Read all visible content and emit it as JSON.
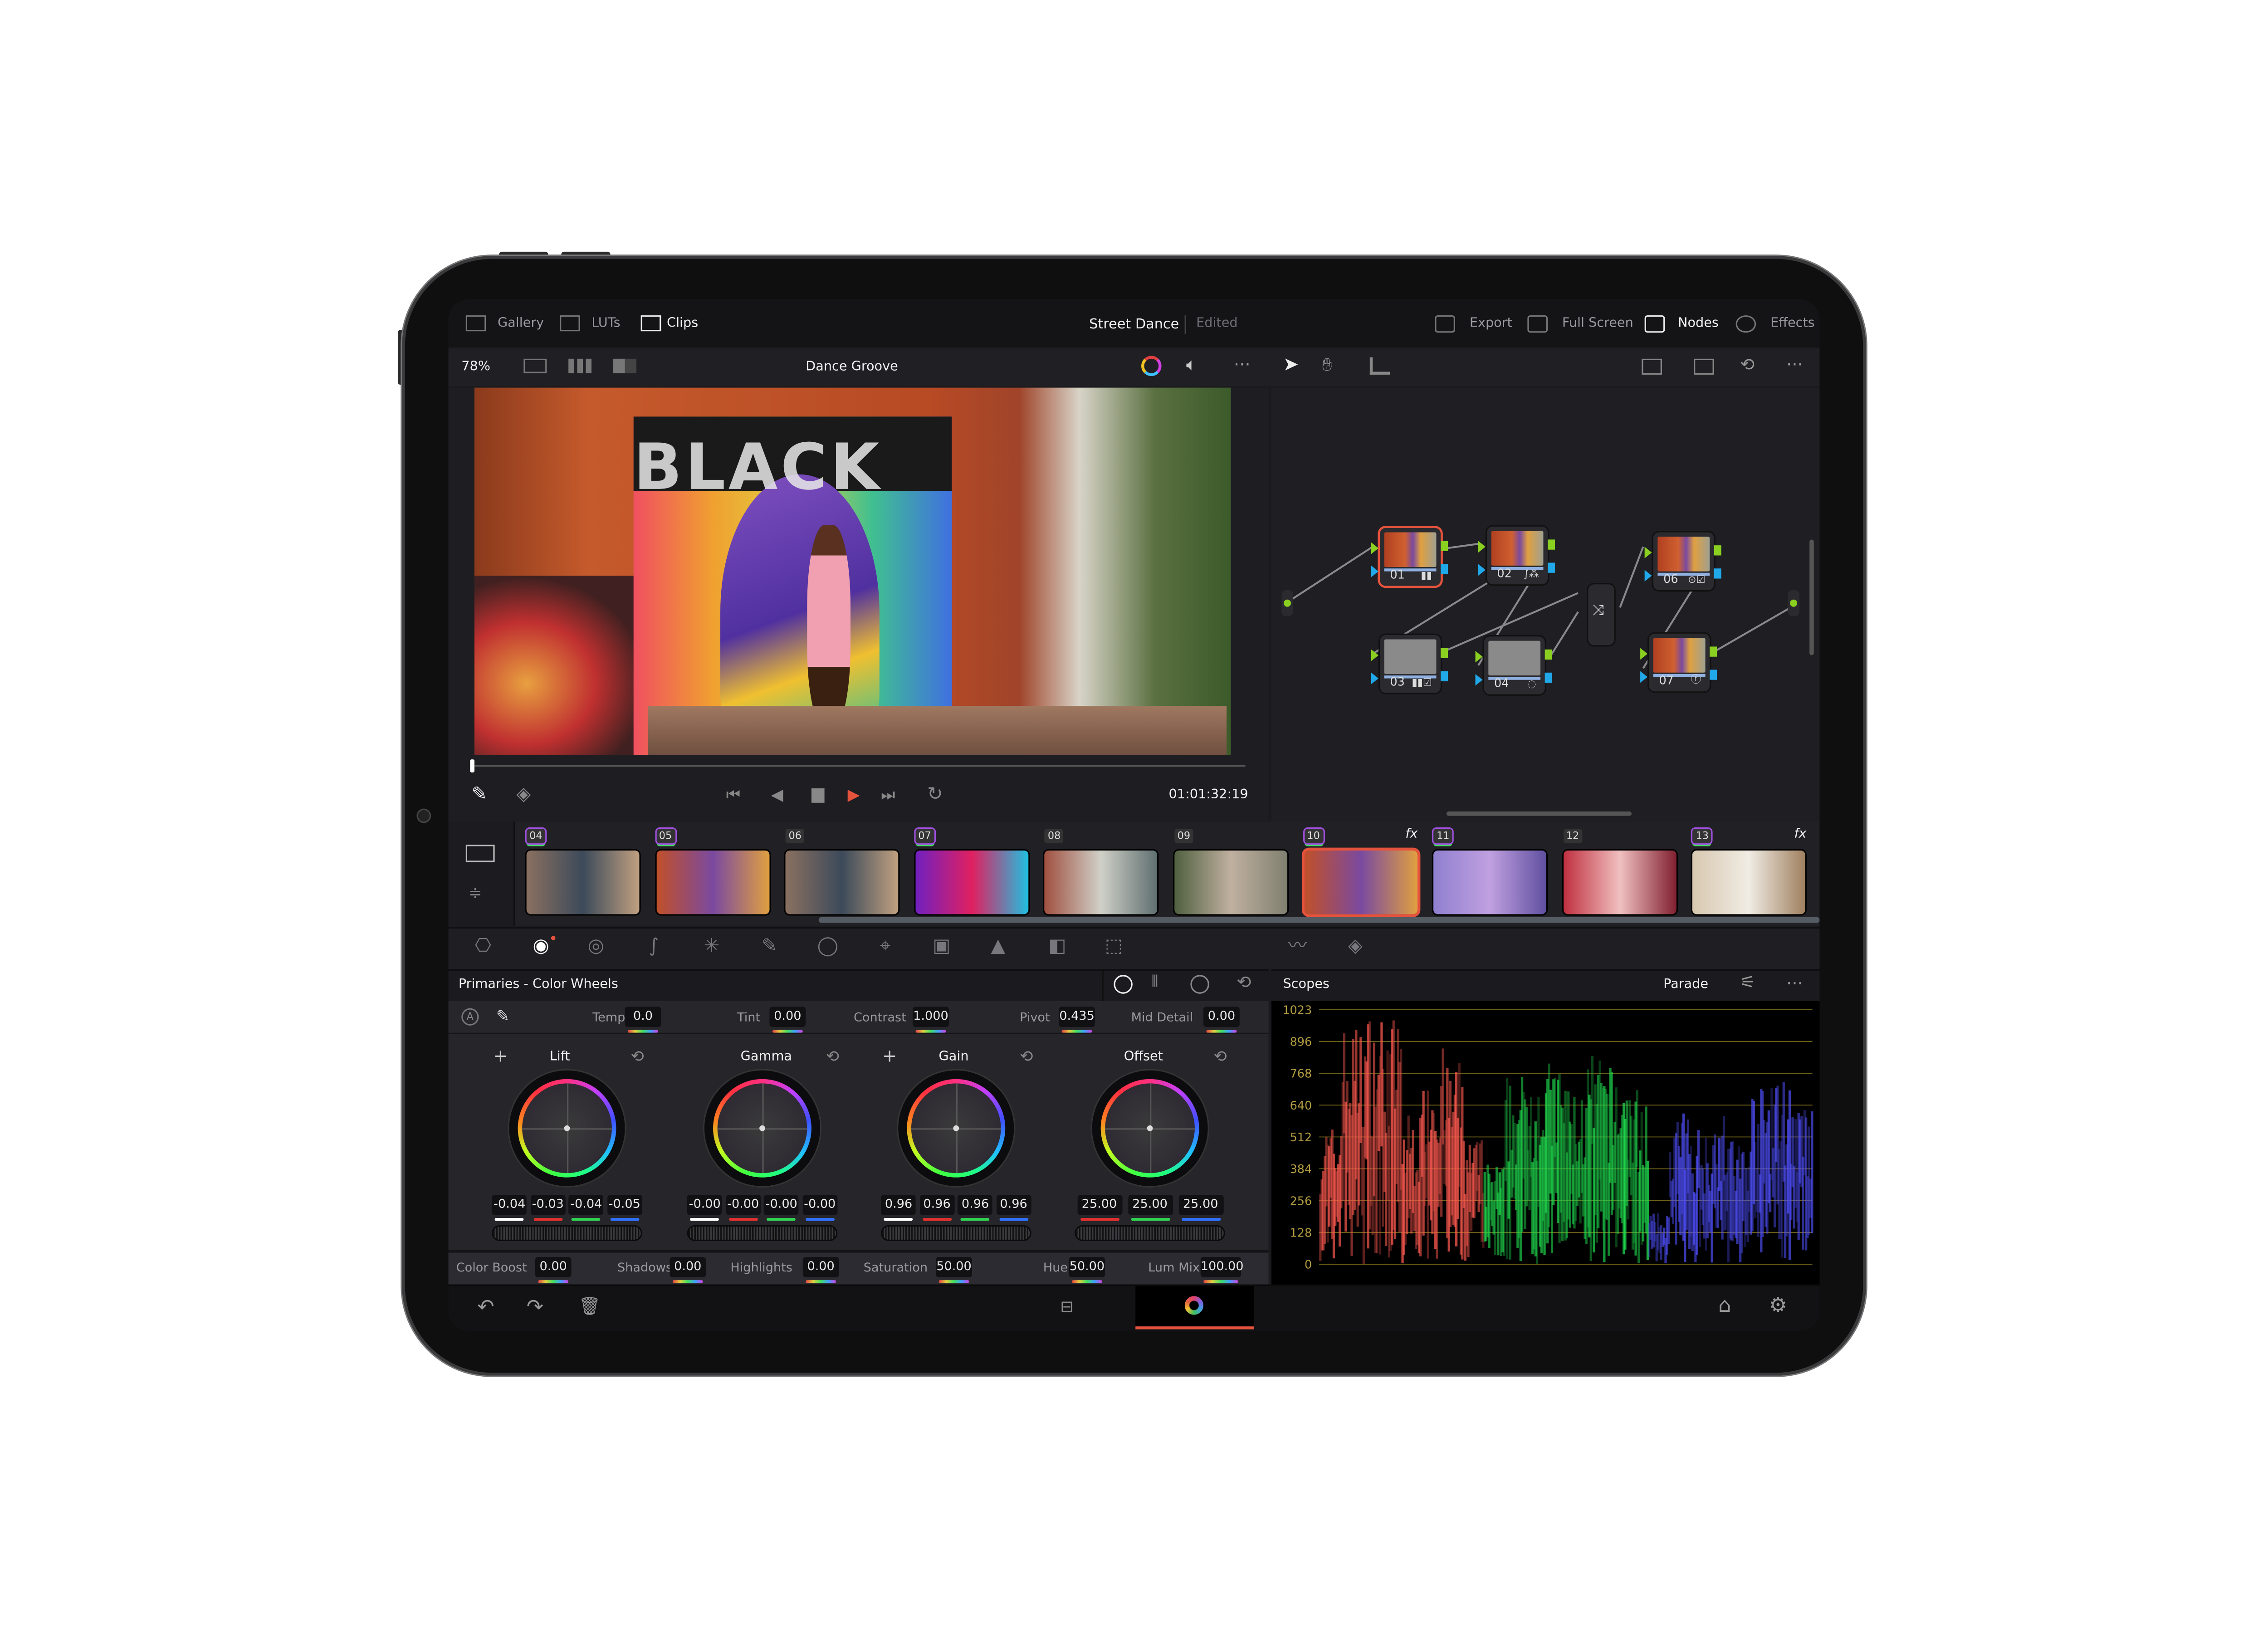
{
  "topbar": {
    "left": [
      {
        "label": "Gallery",
        "icon": "gallery-icon"
      },
      {
        "label": "LUTs",
        "icon": "luts-icon"
      },
      {
        "label": "Clips",
        "icon": "clips-icon",
        "active": true
      }
    ],
    "project_title": "Street Dance",
    "project_status": "Edited",
    "right": [
      {
        "label": "Export",
        "icon": "export-icon"
      },
      {
        "label": "Full Screen",
        "icon": "fullscreen-icon"
      },
      {
        "label": "Nodes",
        "icon": "nodes-icon",
        "active": true
      },
      {
        "label": "Effects",
        "icon": "effects-icon"
      }
    ]
  },
  "viewer": {
    "zoom": "78%",
    "clip_name": "Dance Groove",
    "timecode": "01:01:32:19",
    "playhead_fraction": 0.0
  },
  "clips": [
    {
      "num": "04",
      "flagged": true,
      "fx": false,
      "colors": [
        "#8a7060",
        "#3c4a5a",
        "#c0a080"
      ]
    },
    {
      "num": "05",
      "flagged": true,
      "fx": false,
      "colors": [
        "#c0502a",
        "#7a4aa0",
        "#e0a040"
      ]
    },
    {
      "num": "06",
      "flagged": false,
      "fx": false,
      "colors": [
        "#8a7060",
        "#3c4a5a",
        "#c0a080"
      ]
    },
    {
      "num": "07",
      "flagged": true,
      "fx": false,
      "colors": [
        "#7020c0",
        "#e02060",
        "#20c0e0"
      ]
    },
    {
      "num": "08",
      "flagged": false,
      "fx": false,
      "colors": [
        "#a05040",
        "#d0d0c8",
        "#607070"
      ]
    },
    {
      "num": "09",
      "flagged": false,
      "fx": false,
      "colors": [
        "#506040",
        "#c0b0a0",
        "#808070"
      ]
    },
    {
      "num": "10",
      "flagged": true,
      "fx": true,
      "selected": true,
      "colors": [
        "#c0502a",
        "#7a4aa0",
        "#e0a040"
      ]
    },
    {
      "num": "11",
      "flagged": true,
      "fx": false,
      "colors": [
        "#9080d0",
        "#c0a0e0",
        "#6050a0"
      ]
    },
    {
      "num": "12",
      "flagged": false,
      "fx": false,
      "colors": [
        "#c03040",
        "#f0c0c0",
        "#802030"
      ]
    },
    {
      "num": "13",
      "flagged": true,
      "fx": true,
      "colors": [
        "#d8c8b0",
        "#f0ece4",
        "#a08060"
      ]
    }
  ],
  "fx_label": "fx",
  "nodes": [
    {
      "id": "01",
      "selected": true
    },
    {
      "id": "02"
    },
    {
      "id": "03"
    },
    {
      "id": "04"
    },
    {
      "id": "06"
    },
    {
      "id": "07"
    }
  ],
  "primaries": {
    "title": "Primaries - Color Wheels",
    "top_params": [
      {
        "label": "Temp",
        "value": "0.0"
      },
      {
        "label": "Tint",
        "value": "0.00"
      },
      {
        "label": "Contrast",
        "value": "1.000"
      },
      {
        "label": "Pivot",
        "value": "0.435"
      },
      {
        "label": "Mid Detail",
        "value": "0.00"
      }
    ],
    "wheels": [
      {
        "name": "Lift",
        "values": [
          "-0.04",
          "-0.03",
          "-0.04",
          "-0.05"
        ]
      },
      {
        "name": "Gamma",
        "values": [
          "-0.00",
          "-0.00",
          "-0.00",
          "-0.00"
        ]
      },
      {
        "name": "Gain",
        "values": [
          "0.96",
          "0.96",
          "0.96",
          "0.96"
        ]
      },
      {
        "name": "Offset",
        "values": [
          "25.00",
          "25.00",
          "25.00"
        ]
      }
    ],
    "bottom_params": [
      {
        "label": "Color Boost",
        "value": "0.00"
      },
      {
        "label": "Shadows",
        "value": "0.00"
      },
      {
        "label": "Highlights",
        "value": "0.00"
      },
      {
        "label": "Saturation",
        "value": "50.00"
      },
      {
        "label": "Hue",
        "value": "50.00"
      },
      {
        "label": "Lum Mix",
        "value": "100.00"
      }
    ]
  },
  "scopes": {
    "title": "Scopes",
    "mode": "Parade",
    "ticks": [
      "1023",
      "896",
      "768",
      "640",
      "512",
      "384",
      "256",
      "128",
      "0"
    ],
    "channel_colors": [
      "#ff5a50",
      "#20e050",
      "#5050ff"
    ],
    "grid_color": "#8a7a20"
  },
  "colors": {
    "accent": "#e5533d",
    "flag_gradient": "linear-gradient(#d040e0,#40a0ff,#40e060,#f0c020)"
  }
}
